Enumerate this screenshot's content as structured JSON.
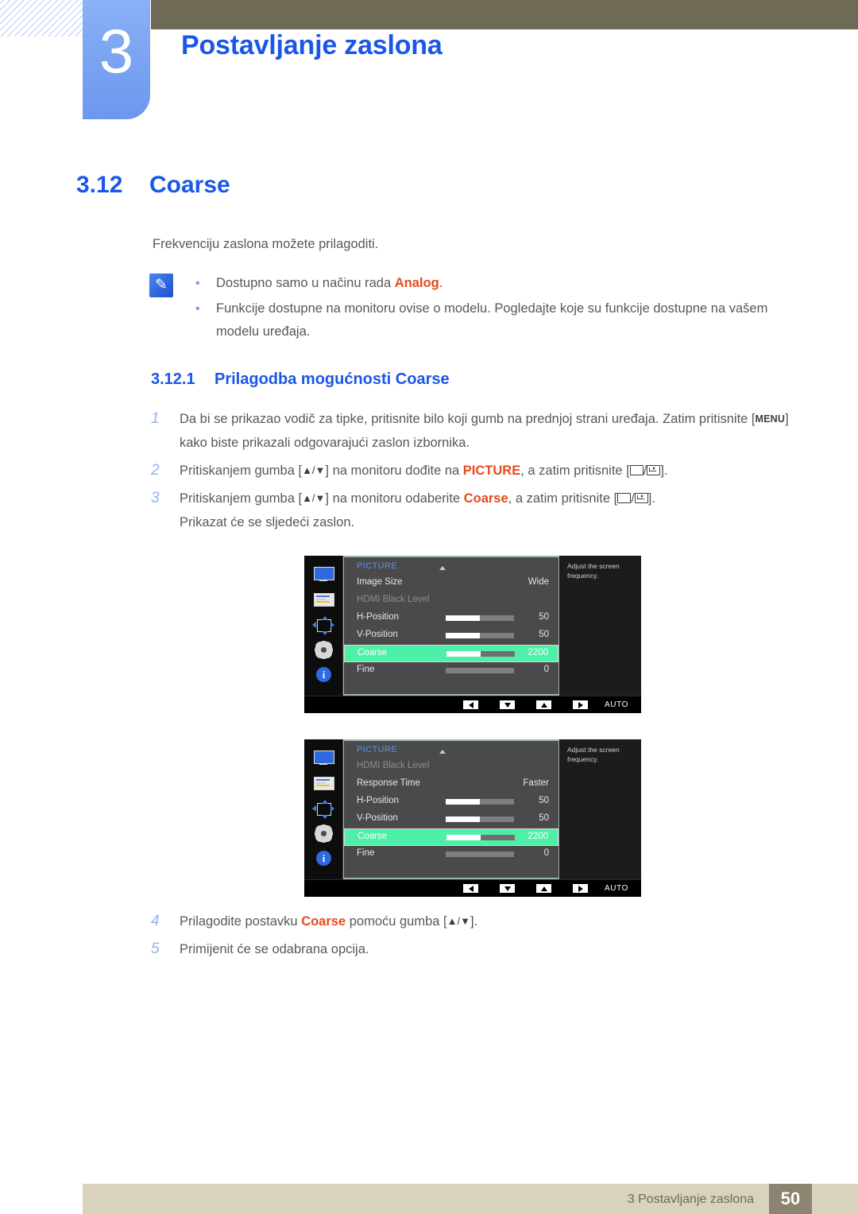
{
  "chapter": {
    "number": "3",
    "title": "Postavljanje zaslona"
  },
  "section": {
    "number": "3.12",
    "title": "Coarse"
  },
  "intro": "Frekvenciju zaslona možete prilagoditi.",
  "note": {
    "icon": "note-pencil-icon",
    "items": [
      {
        "pre": "Dostupno samo u načinu rada ",
        "accent": "Analog",
        "post": "."
      },
      {
        "pre": "Funkcije dostupne na monitoru ovise o modelu. Pogledajte koje su funkcije dostupne na vašem modelu uređaja.",
        "accent": "",
        "post": ""
      }
    ]
  },
  "subsection": {
    "number": "3.12.1",
    "title": "Prilagodba mogućnosti Coarse"
  },
  "steps": [
    {
      "num": "1",
      "part1": "Da bi se prikazao vodič za tipke, pritisnite bilo koji gumb na prednjoj strani uređaja. Zatim pritisnite [",
      "kbd": "MENU",
      "part2": "] kako biste prikazali odgovarajući zaslon izbornika."
    },
    {
      "num": "2",
      "part1": "Pritiskanjem gumba [",
      "arrows": "▲/▼",
      "part2": "] na monitoru dođite na ",
      "accent": "PICTURE",
      "part3": ", a zatim pritisnite [",
      "part4": "]."
    },
    {
      "num": "3",
      "part1": "Pritiskanjem gumba [",
      "arrows": "▲/▼",
      "part2": "] na monitoru odaberite ",
      "accent": "Coarse",
      "part3": ", a zatim pritisnite [",
      "part4": "].",
      "sub": "Prikazat će se sljedeći zaslon."
    }
  ],
  "steps_after": [
    {
      "num": "4",
      "part1": "Prilagodite postavku ",
      "accent": "Coarse",
      "part2": " pomoću gumba [",
      "arrows": "▲/▼",
      "part3": "]."
    },
    {
      "num": "5",
      "part1": "Primijenit će se odabrana opcija.",
      "accent": "",
      "part2": "",
      "arrows": "",
      "part3": ""
    }
  ],
  "osd": {
    "sidebar_icons": [
      "monitor-icon",
      "osd-settings-icon",
      "position-move-icon",
      "gear-icon",
      "info-icon"
    ],
    "help_text": "Adjust the screen frequency.",
    "bottom_bar": {
      "left_label": "left-arrow-button",
      "down_label": "down-arrow-button",
      "up_label": "up-arrow-button",
      "right_label": "right-arrow-button",
      "auto": "AUTO",
      "power": "⏻"
    },
    "screens": [
      {
        "title": "PICTURE",
        "rows": [
          {
            "label": "Image Size",
            "value": "Wide",
            "bar": false,
            "fill": 0,
            "dim": false,
            "hl": false
          },
          {
            "label": "HDMI Black Level",
            "value": "",
            "bar": false,
            "fill": 0,
            "dim": true,
            "hl": false
          },
          {
            "label": "H-Position",
            "value": "50",
            "bar": true,
            "fill": 50,
            "dim": false,
            "hl": false
          },
          {
            "label": "V-Position",
            "value": "50",
            "bar": true,
            "fill": 50,
            "dim": false,
            "hl": false
          },
          {
            "label": "Coarse",
            "value": "2200",
            "bar": true,
            "fill": 50,
            "dim": false,
            "hl": true
          },
          {
            "label": "Fine",
            "value": "0",
            "bar": true,
            "fill": 0,
            "dim": false,
            "hl": false
          }
        ]
      },
      {
        "title": "PICTURE",
        "rows": [
          {
            "label": "HDMI Black Level",
            "value": "",
            "bar": false,
            "fill": 0,
            "dim": true,
            "hl": false
          },
          {
            "label": "Response Time",
            "value": "Faster",
            "bar": false,
            "fill": 0,
            "dim": false,
            "hl": false
          },
          {
            "label": "H-Position",
            "value": "50",
            "bar": true,
            "fill": 50,
            "dim": false,
            "hl": false
          },
          {
            "label": "V-Position",
            "value": "50",
            "bar": true,
            "fill": 50,
            "dim": false,
            "hl": false
          },
          {
            "label": "Coarse",
            "value": "2200",
            "bar": true,
            "fill": 50,
            "dim": false,
            "hl": true
          },
          {
            "label": "Fine",
            "value": "0",
            "bar": true,
            "fill": 0,
            "dim": false,
            "hl": false
          }
        ]
      }
    ]
  },
  "footer": {
    "text": "3 Postavljanje zaslona",
    "page": "50"
  },
  "colors": {
    "accent_orange": "#e8491c",
    "heading_blue": "#1a56e8",
    "chapter_tab_blue": "#6c97ef",
    "olive": "#6e6a55",
    "footer_bg": "#d9d2bd",
    "footer_page_bg": "#8d8371",
    "osd_highlight_green": "#4ef0a8"
  }
}
